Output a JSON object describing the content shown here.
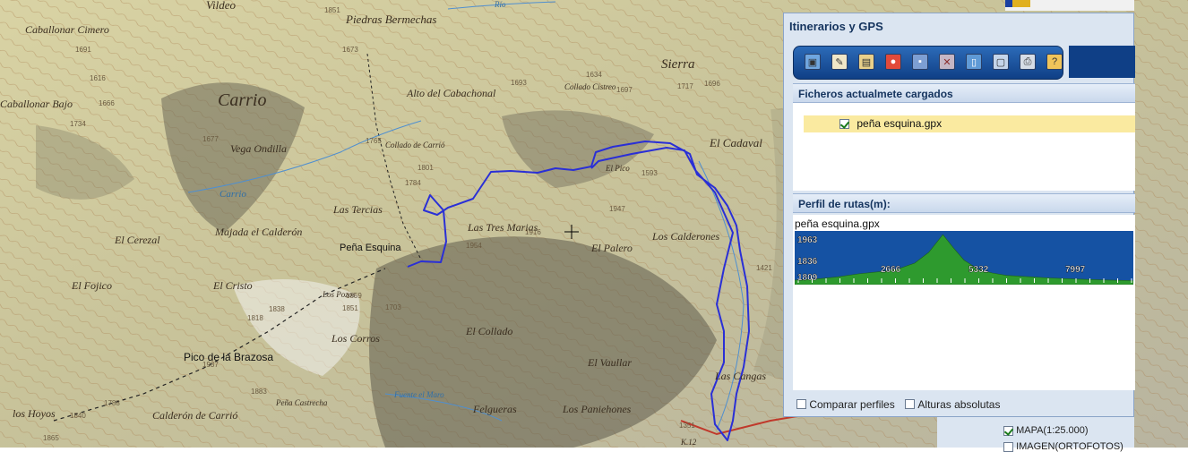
{
  "map": {
    "labels": [
      "Vildeo",
      "Piedras Bermechas",
      "Caballonar Cimero",
      "Sierra",
      "Alto del Cabachonal",
      "Collado Cistreo",
      "Carrio",
      "Caballonar Bajo",
      "Vega Ondilla",
      "Collado de Carrió",
      "El Cadaval",
      "El Pico",
      "Las Tercias",
      "Las Tres Marias",
      "El Cerezal",
      "Majada el Calderón",
      "Peña Esquina",
      "El Palero",
      "Los Calderones",
      "El Fojico",
      "El Cristo",
      "Los Pozos",
      "Los Corros",
      "El Collado",
      "Pico de la Brazosa",
      "El Vaullar",
      "Las Cangas",
      "Peña Castrecha",
      "Felgueras",
      "Los Paniehones",
      "los Hoyos",
      "Calderón de Carrió",
      "K.12"
    ],
    "water_labels": [
      "Carrio",
      "Fuente el Maro",
      "Río"
    ],
    "elevations": [
      "1851",
      "1673",
      "1691",
      "1616",
      "1666",
      "1734",
      "1677",
      "1765",
      "1801",
      "1784",
      "1634",
      "1693",
      "1697",
      "1717",
      "1696",
      "1954",
      "1916",
      "1859",
      "1838",
      "1818",
      "1851",
      "1703",
      "1937",
      "1883",
      "1788",
      "1840",
      "1865",
      "1421",
      "1351",
      "1593",
      "1947"
    ]
  },
  "panel": {
    "title": "Itinerarios y GPS",
    "toolbar": [
      "new-icon",
      "edit-pencil-icon",
      "map-icon",
      "pin-icon",
      "save-icon",
      "delete-icon",
      "clipboard-icon",
      "window-icon",
      "print-icon",
      "help-icon"
    ],
    "files_header": "Ficheros actualmete cargados",
    "file": {
      "name": "peña esquina.gpx",
      "checked": true
    },
    "profile_header": "Perfil de rutas(m):",
    "profile_name": "peña esquina.gpx",
    "compare_label": "Comparar perfiles",
    "absolute_label": "Alturas absolutas"
  },
  "chart_data": {
    "type": "area",
    "title": "peña esquina.gpx",
    "ytick_labels": [
      "1963",
      "1836",
      "1809"
    ],
    "xtick_labels": [
      "2666",
      "5332",
      "7997"
    ],
    "x": [
      0,
      600,
      1200,
      1800,
      2400,
      2900,
      3400,
      3800,
      4200,
      4500,
      4800,
      5200,
      5600,
      6000,
      6600,
      7200,
      7997,
      8900,
      9600
    ],
    "y": [
      1815,
      1818,
      1825,
      1835,
      1842,
      1850,
      1870,
      1905,
      1963,
      1920,
      1880,
      1850,
      1838,
      1830,
      1826,
      1822,
      1818,
      1815,
      1813
    ],
    "ylim": [
      1800,
      1975
    ],
    "xlim": [
      0,
      9600
    ]
  },
  "layers": [
    {
      "label": "MAPA(1:25.000)",
      "checked": true
    },
    {
      "label": "IMAGEN(ORTOFOTOS)",
      "checked": false
    }
  ],
  "colors": {
    "track": "#2a2fd6",
    "panel_bg": "#dbe5f1",
    "profile_fill": "#2e9a2e",
    "profile_sky": "#1552a3"
  }
}
